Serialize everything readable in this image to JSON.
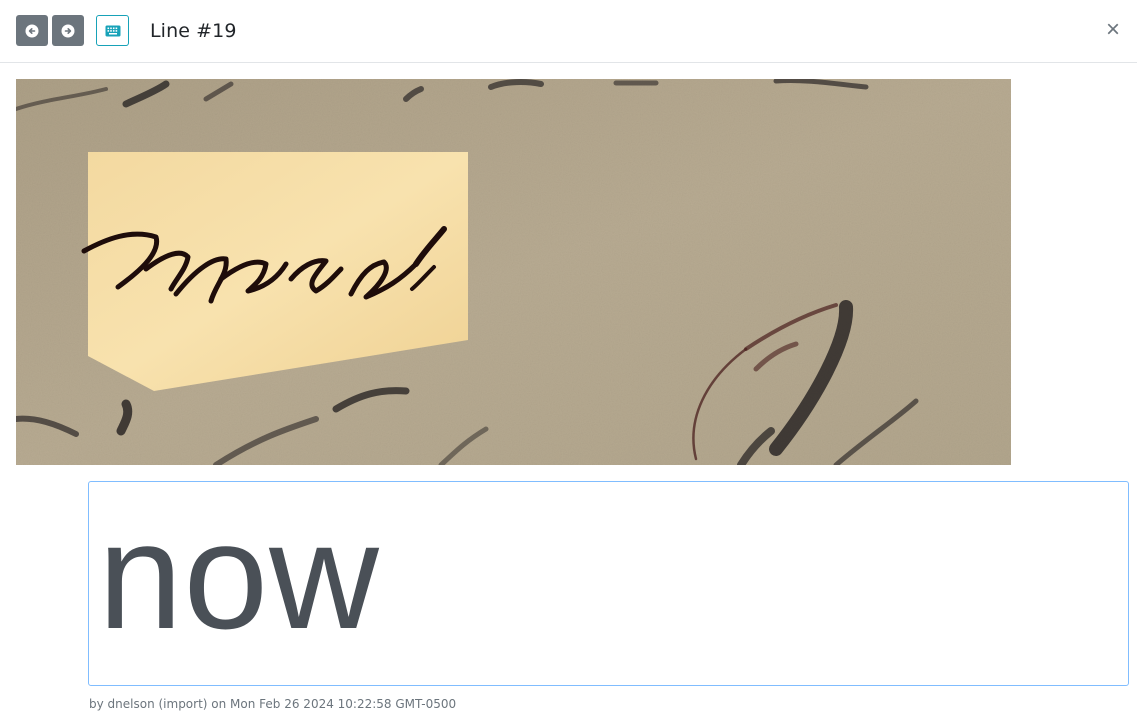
{
  "header": {
    "title": "Line #19",
    "prev_icon": "arrow-left-circle-icon",
    "next_icon": "arrow-right-circle-icon",
    "keyboard_icon": "keyboard-icon",
    "close_label": "×"
  },
  "image": {
    "description_icon": "manuscript-line-image"
  },
  "editor": {
    "text": "now"
  },
  "meta": {
    "text": "by dnelson (import) on Mon Feb 26 2024 10:22:58 GMT-0500"
  },
  "colors": {
    "nav_button": "#6c757d",
    "keyboard_border": "#17a2b8",
    "editor_border": "#80bdff",
    "highlight": "#f7dfa5",
    "paper": "#b5a88e",
    "ink": "#2a1c18"
  }
}
